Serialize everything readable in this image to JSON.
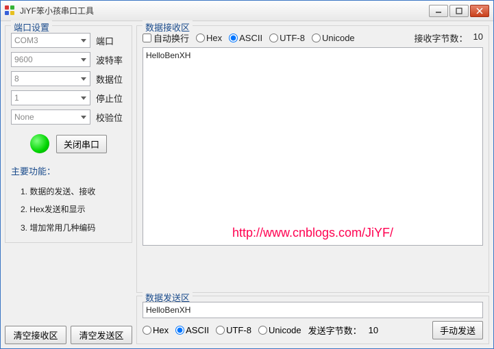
{
  "window": {
    "title": "JiYF笨小孩串口工具"
  },
  "port_settings": {
    "group_title": "端口设置",
    "port": {
      "value": "COM3",
      "label": "端口"
    },
    "baud": {
      "value": "9600",
      "label": "波特率"
    },
    "databits": {
      "value": "8",
      "label": "数据位"
    },
    "stopbits": {
      "value": "1",
      "label": "停止位"
    },
    "parity": {
      "value": "None",
      "label": "校验位"
    },
    "close_btn": "关闭串口"
  },
  "features": {
    "title": "主要功能：",
    "items": [
      "1. 数据的发送、接收",
      "2. Hex发送和显示",
      "3. 增加常用几种编码"
    ]
  },
  "bottom": {
    "clear_recv": "清空接收区",
    "clear_send": "清空发送区"
  },
  "recv": {
    "group_title": "数据接收区",
    "autowrap": "自动换行",
    "enc": {
      "hex": "Hex",
      "ascii": "ASCII",
      "utf8": "UTF-8",
      "unicode": "Unicode"
    },
    "count_label": "接收字节数：",
    "count": "10",
    "text": "HelloBenXH"
  },
  "watermark": "http://www.cnblogs.com/JiYF/",
  "send": {
    "group_title": "数据发送区",
    "text": "HelloBenXH",
    "enc": {
      "hex": "Hex",
      "ascii": "ASCII",
      "utf8": "UTF-8",
      "unicode": "Unicode"
    },
    "count_label": "发送字节数：",
    "count": "10",
    "send_btn": "手动发送"
  }
}
